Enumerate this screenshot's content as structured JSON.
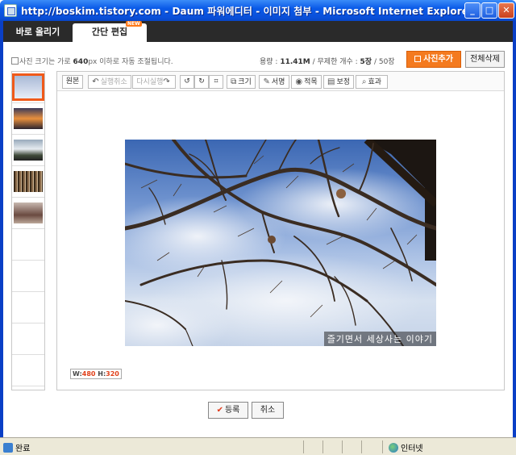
{
  "window": {
    "title": "http://boskim.tistory.com - Daum 파워에디터 - 이미지 첨부 - Microsoft Internet Explorer",
    "minimize": "_",
    "maximize": "□",
    "close": "✕"
  },
  "tabs": [
    {
      "label": "바로 올리기"
    },
    {
      "label": "간단 편집",
      "badge": "NEW"
    }
  ],
  "info": {
    "note_prefix": "사진 크기는 가로 ",
    "note_bold": "640",
    "note_suffix": "px 이하로 자동 조절됩니다.",
    "capacity_label": "용량 : ",
    "capacity_value": "11.41M",
    "capacity_limit": " / 무제한  개수 : ",
    "count_value": "5장",
    "count_limit": " / 50장"
  },
  "actions": {
    "add_photo": "사진추가",
    "delete_all": "전체삭제"
  },
  "thumbnails": [
    {
      "name": "photo-1",
      "selected": true
    },
    {
      "name": "photo-2",
      "selected": false
    },
    {
      "name": "photo-3",
      "selected": false
    },
    {
      "name": "photo-4",
      "selected": false
    },
    {
      "name": "photo-5",
      "selected": false
    }
  ],
  "toolbar": {
    "original": "원본",
    "undo": "실행취소",
    "redo": "다시실행",
    "rotate_left": "↺",
    "rotate_right": "↻",
    "crop": "⌗",
    "resize": "크기",
    "signature": "서명",
    "stamp": "적목",
    "correction": "보정",
    "effect": "효과"
  },
  "photo": {
    "caption": "즐기면서 세상사는 이야기",
    "width_label": "W:",
    "width": "480",
    "height_label": " H:",
    "height": "320"
  },
  "footer": {
    "register": "등록",
    "cancel": "취소"
  },
  "status": {
    "left": "완료",
    "zone": "인터넷"
  },
  "colors": {
    "accent": "#f47a1f",
    "title_bar": "#0a5ae8",
    "selection": "#f05a1a"
  }
}
